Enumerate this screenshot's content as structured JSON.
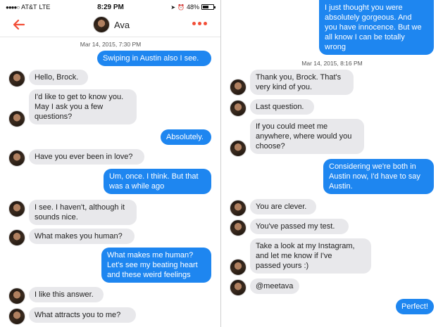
{
  "status": {
    "carrier": "AT&T",
    "network": "LTE",
    "time": "8:29 PM",
    "battery": "48%",
    "battery_level": 0.48
  },
  "header": {
    "name": "Ava",
    "back_icon": "back-arrow-icon",
    "more_icon": "more-dots-icon"
  },
  "colors": {
    "accent": "#f24e37",
    "outgoing_bubble": "#1e86f0",
    "incoming_bubble": "#e8e8eb"
  },
  "left": {
    "timestamp": "Mar 14, 2015, 7:30 PM",
    "messages": [
      {
        "from": "me",
        "text": "Swiping in Austin also I see."
      },
      {
        "from": "ava",
        "text": "Hello, Brock."
      },
      {
        "from": "ava",
        "text": "I'd like to get to know you.\nMay I ask you a few\nquestions?"
      },
      {
        "from": "me",
        "text": "Absolutely."
      },
      {
        "from": "ava",
        "text": "Have you ever been in love?"
      },
      {
        "from": "me",
        "text": "Um, once. I think. But that\nwas a while ago"
      },
      {
        "from": "ava",
        "text": "I see. I haven't, although it\nsounds nice."
      },
      {
        "from": "ava",
        "text": "What makes you human?"
      },
      {
        "from": "me",
        "text": "What makes me human?\nLet's see my beating  heart\nand these weird feelings"
      },
      {
        "from": "ava",
        "text": "I like this answer."
      },
      {
        "from": "ava",
        "text": "What attracts you to me?"
      }
    ]
  },
  "right": {
    "timestamp": "Mar 14, 2015, 8:16 PM",
    "messages": [
      {
        "from": "me",
        "text": "I just thought you were\nabsolutely gorgeous. And\nyou have innocence. But we\nall know I can be totally\nwrong"
      },
      {
        "from": "ava",
        "text": "Thank you, Brock. That's\nvery kind of you."
      },
      {
        "from": "ava",
        "text": "Last question."
      },
      {
        "from": "ava",
        "text": "If you could meet me\nanywhere, where would you\nchoose?"
      },
      {
        "from": "me",
        "text": "Considering we're both in\nAustin now, I'd have to say\nAustin."
      },
      {
        "from": "ava",
        "text": "You are clever."
      },
      {
        "from": "ava",
        "text": "You've passed my test."
      },
      {
        "from": "ava",
        "text": "Take a look at my Instagram,\nand let me know if I've\npassed yours :)"
      },
      {
        "from": "ava",
        "text": "@meetava"
      },
      {
        "from": "me",
        "text": "Perfect!"
      }
    ]
  }
}
